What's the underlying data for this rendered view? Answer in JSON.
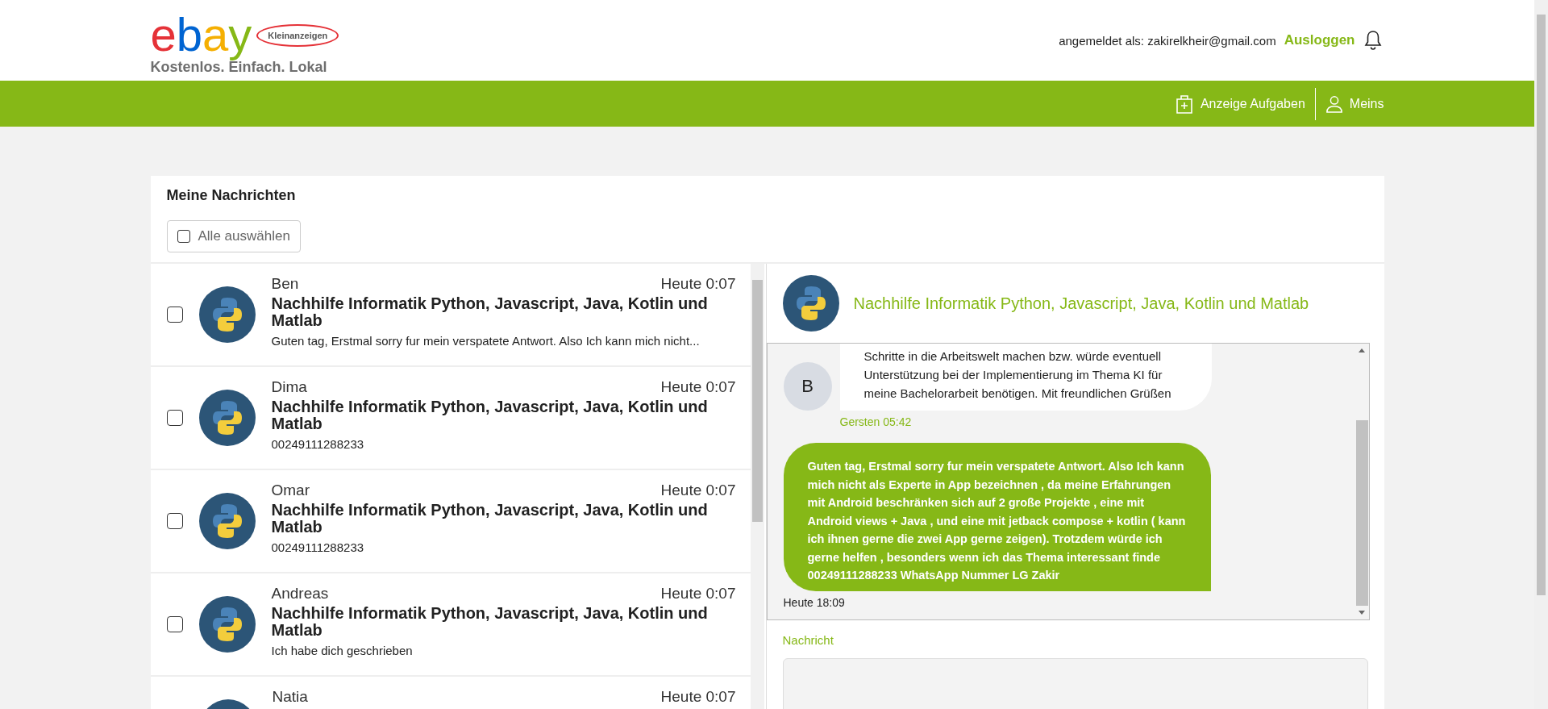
{
  "header": {
    "logo": {
      "letters": [
        {
          "char": "e",
          "color": "#e53238"
        },
        {
          "char": "b",
          "color": "#0064d2"
        },
        {
          "char": "a",
          "color": "#f5af02"
        },
        {
          "char": "y",
          "color": "#86b817"
        }
      ],
      "badge": "Kleinanzeigen"
    },
    "tagline": "Kostenlos. Einfach. Lokal",
    "signed_in_label": "angemeldet als: zakirelkheir@gmail.com",
    "logout": "Ausloggen"
  },
  "nav": [
    {
      "kind": "post",
      "label": "Anzeige Aufgaben"
    },
    {
      "kind": "user",
      "label": "Meins"
    }
  ],
  "inbox": {
    "title": "Meine Nachrichten",
    "select_all": {
      "label": "Alle auswählen",
      "checked": false
    },
    "conversations": [
      {
        "name": "Ben",
        "time": "Heute 0:07",
        "subject": "Nachhilfe Informatik Python, Javascript, Java, Kotlin und Matlab",
        "preview": "Guten tag, Erstmal sorry fur mein verspatete Antwort. Also Ich kann mich nicht...",
        "checked": false
      },
      {
        "name": "Dima",
        "time": "Heute 0:07",
        "subject": "Nachhilfe Informatik Python, Javascript, Java, Kotlin und Matlab",
        "preview": "00249111288233",
        "checked": false
      },
      {
        "name": "Omar",
        "time": "Heute 0:07",
        "subject": "Nachhilfe Informatik Python, Javascript, Java, Kotlin und Matlab",
        "preview": "00249111288233",
        "checked": false
      },
      {
        "name": "Andreas",
        "time": "Heute 0:07",
        "subject": "Nachhilfe Informatik Python, Javascript, Java, Kotlin und Matlab",
        "preview": "Ich habe dich geschrieben",
        "checked": false
      },
      {
        "name": "Natia",
        "time": "Heute 0:07"
      }
    ]
  },
  "chat": {
    "title": "Nachhilfe Informatik Python, Javascript, Java, Kotlin und Matlab",
    "messages": [
      {
        "kind": "received",
        "initial": "B",
        "lines": [
          "Schritte in die Arbeitswelt machen bzw. würde eventuell",
          "Unterstützung bei der Implementierung im Thema KI für",
          "meine Bachelorarbeit benötigen. Mit freundlichen Grüßen"
        ],
        "time": "Gersten 05:42"
      },
      {
        "kind": "sent",
        "text": "Guten tag, Erstmal sorry fur mein verspatete Antwort. Also Ich kann mich nicht als Experte in App bezeichnen , da meine Erfahrungen mit Android beschränken sich auf 2 große Projekte , eine mit Android views + Java , und eine mit jetback compose + kotlin ( kann ich ihnen gerne die zwei App gerne zeigen). Trotzdem würde ich gerne helfen , besonders wenn ich das Thema interessant finde 00249111288233 WhatsApp Nummer LG Zakir",
        "time": "Heute 18:09"
      }
    ],
    "input_label": "Nachricht"
  }
}
